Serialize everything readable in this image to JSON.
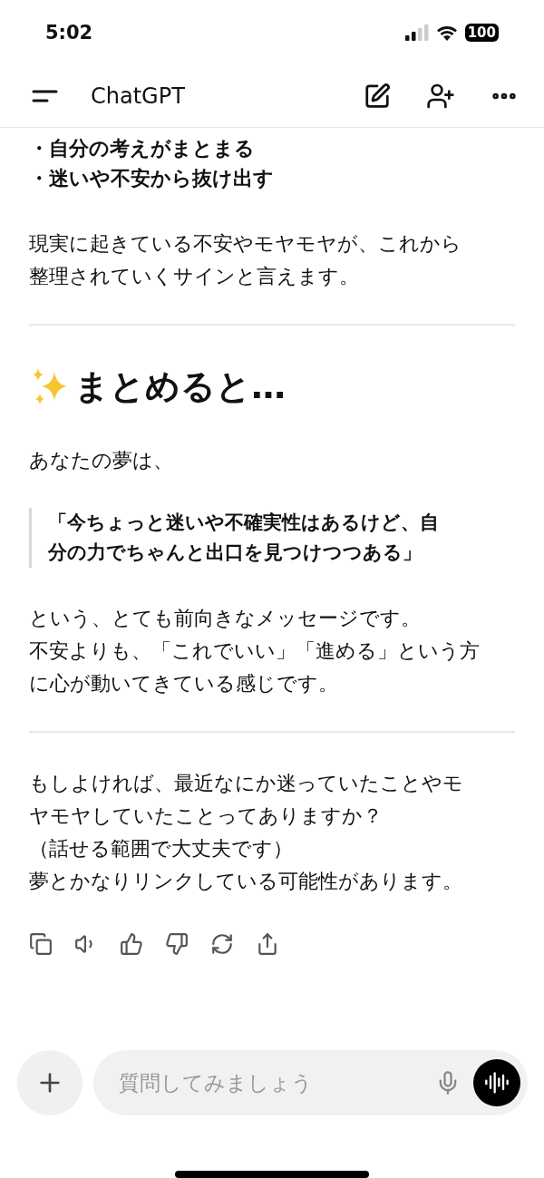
{
  "status_bar": {
    "time": "5:02",
    "battery": "100"
  },
  "header": {
    "title": "ChatGPT"
  },
  "message": {
    "blocks": [
      {
        "kind": "bullets",
        "items": [
          "・自分の考えがまとまる",
          "・迷いや不安から抜け出す"
        ]
      },
      {
        "kind": "paragraph",
        "lines": [
          "現実に起きている不安やモヤモヤが、これから",
          "整理されていくサインと言えます。"
        ]
      },
      {
        "kind": "divider"
      },
      {
        "kind": "heading",
        "text": "まとめると…"
      },
      {
        "kind": "paragraph",
        "lines": [
          "あなたの夢は、"
        ]
      },
      {
        "kind": "quote",
        "lines": [
          "「今ちょっと迷いや不確実性はあるけど、自",
          "分の力でちゃんと出口を見つけつつある」"
        ]
      },
      {
        "kind": "paragraph",
        "lines": [
          "という、とても前向きなメッセージです。",
          "不安よりも、「これでいい」「進める」という方",
          "に心が動いてきている感じです。"
        ]
      },
      {
        "kind": "divider"
      },
      {
        "kind": "paragraph",
        "lines": [
          "もしよければ、最近なにか迷っていたことやモ",
          "ヤモヤしていたことってありますか？",
          "（話せる範囲で大丈夫です）",
          "夢とかなりリンクしている可能性があります。"
        ]
      }
    ]
  },
  "composer": {
    "placeholder": "質問してみましょう"
  }
}
